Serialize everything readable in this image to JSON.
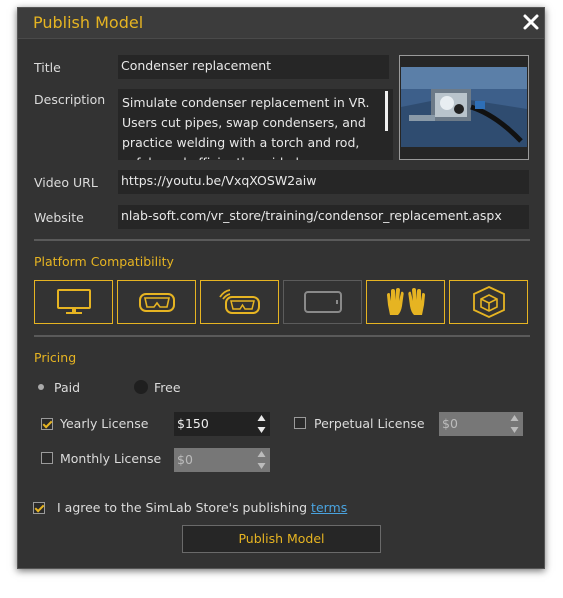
{
  "dialog": {
    "title": "Publish Model",
    "close_icon": "close-icon"
  },
  "form": {
    "title_label": "Title",
    "title_value": "Condenser replacement",
    "description_label": "Description",
    "description_value": "Simulate condenser replacement in VR. Users cut pipes, swap condensers, and practice welding with a torch and rod, safely and efficiently guided.",
    "video_url_label": "Video URL",
    "video_url_value": "https://youtu.be/VxqXOSW2aiw",
    "website_label": "Website",
    "website_value": "nlab-soft.com/vr_store/training/condensor_replacement.aspx"
  },
  "platform": {
    "heading": "Platform Compatibility",
    "items": [
      {
        "icon": "desktop-monitor-icon",
        "selected": true
      },
      {
        "icon": "vr-headset-icon",
        "selected": true
      },
      {
        "icon": "wireless-vr-headset-icon",
        "selected": true
      },
      {
        "icon": "tablet-icon",
        "selected": false
      },
      {
        "icon": "hands-icon",
        "selected": true
      },
      {
        "icon": "ar-cube-icon",
        "selected": true
      }
    ]
  },
  "pricing": {
    "heading": "Pricing",
    "paid_label": "Paid",
    "free_label": "Free",
    "selected": "Paid",
    "yearly_label": "Yearly License",
    "yearly_checked": true,
    "yearly_price": "$150",
    "perpetual_label": "Perpetual License",
    "perpetual_checked": false,
    "perpetual_price": "$0",
    "monthly_label": "Monthly License",
    "monthly_checked": false,
    "monthly_price": "$0"
  },
  "agreement": {
    "text": "I agree to the SimLab Store's publishing ",
    "link": "terms",
    "checked": true
  },
  "publish_button": "Publish Model",
  "colors": {
    "accent": "#e6b422",
    "background": "#333333",
    "field": "#262626",
    "link": "#4aa3df"
  }
}
